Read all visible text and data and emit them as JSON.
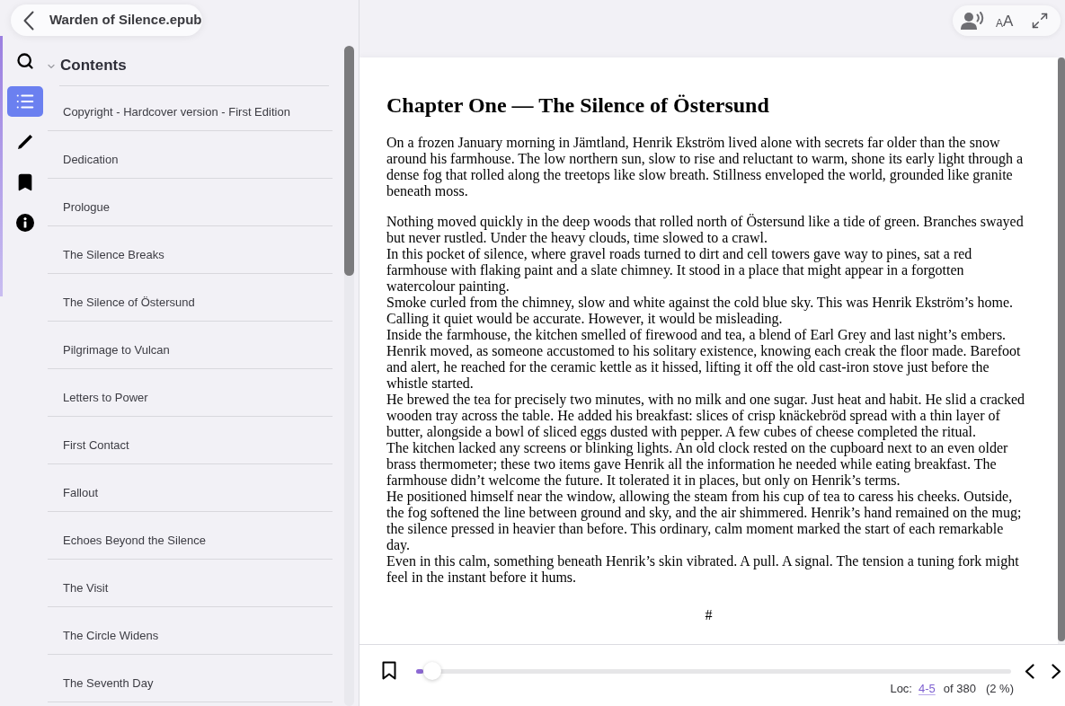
{
  "header": {
    "title": "Warden of Silence.epub"
  },
  "rail": [
    {
      "kind": "search",
      "selected": false
    },
    {
      "kind": "contents",
      "selected": true
    },
    {
      "kind": "annotations",
      "selected": false
    },
    {
      "kind": "bookmarks",
      "selected": false
    },
    {
      "kind": "info",
      "selected": false
    }
  ],
  "contents": {
    "title": "Contents",
    "expanded": true,
    "items": [
      "Copyright - Hardcover version - First Edition",
      "Dedication",
      "Prologue",
      "The Silence Breaks",
      "The Silence of Östersund",
      "Pilgrimage to Vulcan",
      "Letters to Power",
      "First Contact",
      "Fallout",
      "Echoes Beyond the Silence",
      "The Visit",
      "The Circle Widens",
      "The Seventh Day"
    ]
  },
  "toolbar": {
    "font_button": "AA"
  },
  "chapter": {
    "title": "Chapter One — The Silence of Östersund",
    "sections": [
      [
        "On a frozen January morning in Jämtland, Henrik Ekström lived alone with secrets far older than the snow around his farmhouse. The low northern sun, slow to rise and reluctant to warm, shone its early light through a dense fog that rolled along the treetops like slow breath. Stillness enveloped the world, grounded like granite beneath moss."
      ],
      [
        "Nothing moved quickly in the deep woods that rolled north of Östersund like a tide of green. Branches swayed but never rustled. Under the heavy clouds, time slowed to a crawl.",
        "In this pocket of silence, where gravel roads turned to dirt and cell towers gave way to pines, sat a red farmhouse with flaking paint and a slate chimney. It stood in a place that might appear in a forgotten watercolour painting.",
        "Smoke curled from the chimney, slow and white against the cold blue sky. This was Henrik Ekström’s home. Calling it quiet would be accurate. However, it would be misleading.",
        "Inside the farmhouse, the kitchen smelled of firewood and tea, a blend of Earl Grey and last night’s embers. Henrik moved, as someone accustomed to his solitary existence, knowing each creak the floor made. Barefoot and alert, he reached for the ceramic kettle as it hissed, lifting it off the old cast-iron stove just before the whistle started.",
        "He brewed the tea for precisely two minutes, with no milk and one sugar. Just heat and habit. He slid a cracked wooden tray across the table. He added his breakfast: slices of crisp knäckebröd spread with a thin layer of butter, alongside a bowl of sliced eggs dusted with pepper. A few cubes of cheese completed the ritual.",
        "The kitchen lacked any screens or blinking lights. An old clock rested on the cupboard next to an even older brass thermometer; these two items gave Henrik all the information he needed while eating breakfast. The farmhouse didn’t welcome the future. It tolerated it in places, but only on Henrik’s terms.",
        "He positioned himself near the window, allowing the steam from his cup of tea to caress his cheeks. Outside, the fog softened the line between ground and sky, and the air shimmered. Henrik’s hand remained on the mug; the silence pressed in heavier than before. This ordinary, calm moment marked the start of each remarkable day.",
        "Even in this calm, something beneath Henrik’s skin vibrated. A pull. A signal. The tension a tuning fork might feel in the instant before it hums."
      ]
    ],
    "scene_break": "#"
  },
  "footer": {
    "progress": {
      "level": 0.02
    },
    "location": {
      "label": "Loc:",
      "range": "4-5",
      "total": "of 380",
      "percent": "(2 %)"
    }
  }
}
